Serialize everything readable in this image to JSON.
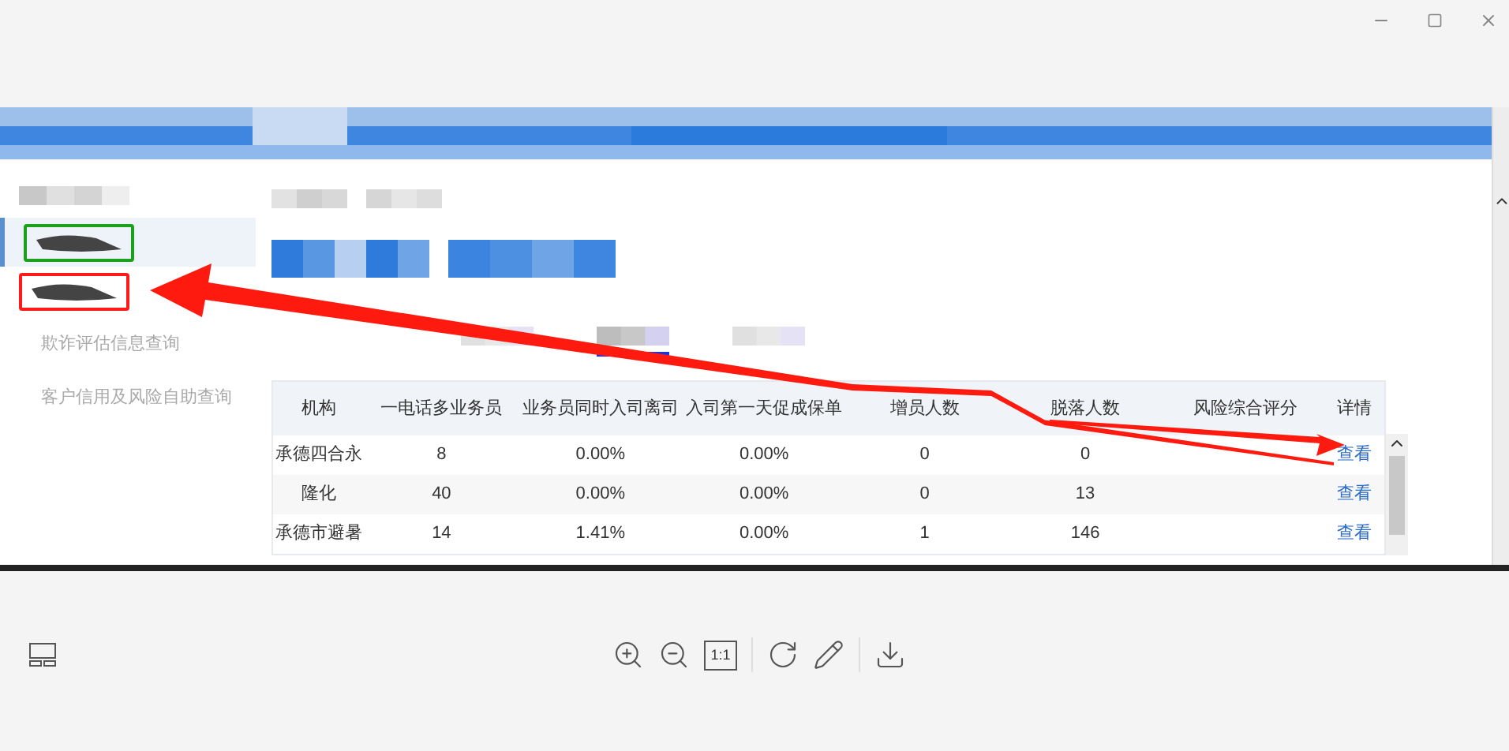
{
  "window": {
    "controls": [
      {
        "kind": "minimize"
      },
      {
        "kind": "maximize"
      },
      {
        "kind": "close"
      }
    ]
  },
  "sidebar": {
    "items": [
      {
        "kind": "redacted",
        "selected": true,
        "color": "#1aa31a"
      },
      {
        "kind": "redacted",
        "selected": false,
        "color": "#ff1a1a"
      },
      {
        "kind": "text",
        "label": "欺诈评估信息查询",
        "selected": false
      },
      {
        "kind": "text",
        "label": "客户信用及风险自助查询",
        "selected": false
      }
    ]
  },
  "tabs": [
    {
      "selected": false
    },
    {
      "selected": true
    },
    {
      "selected": false
    }
  ],
  "table": {
    "columns": [
      "机构",
      "一电话多业务员",
      "业务员同时入司离司",
      "入司第一天促成保单",
      "增员人数",
      "脱落人数",
      "风险综合评分",
      "详情"
    ],
    "rows": [
      {
        "cells": [
          "承德四合永",
          "8",
          "0.00%",
          "0.00%",
          "0",
          "0",
          ""
        ],
        "link": "查看"
      },
      {
        "cells": [
          "隆化",
          "40",
          "0.00%",
          "0.00%",
          "0",
          "13",
          ""
        ],
        "link": "查看"
      },
      {
        "cells": [
          "承德市避暑",
          "14",
          "1.41%",
          "0.00%",
          "1",
          "146",
          ""
        ],
        "link": "查看"
      }
    ]
  },
  "toolbar": [
    {
      "kind": "layout"
    },
    {
      "kind": "zoom-in"
    },
    {
      "kind": "zoom-out"
    },
    {
      "kind": "actual-size",
      "label": "1:1"
    },
    {
      "kind": "divider"
    },
    {
      "kind": "rotate"
    },
    {
      "kind": "edit"
    },
    {
      "kind": "divider"
    },
    {
      "kind": "download"
    }
  ]
}
